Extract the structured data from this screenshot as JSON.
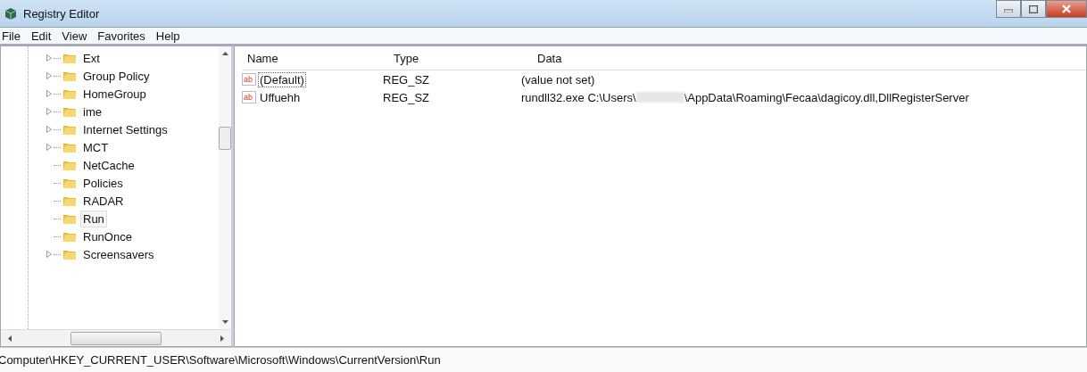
{
  "window": {
    "title": "Registry Editor"
  },
  "menu": [
    "File",
    "Edit",
    "View",
    "Favorites",
    "Help"
  ],
  "tree": [
    {
      "label": "Ext",
      "expandable": true,
      "selected": false
    },
    {
      "label": "Group Policy",
      "expandable": true,
      "selected": false
    },
    {
      "label": "HomeGroup",
      "expandable": true,
      "selected": false
    },
    {
      "label": "ime",
      "expandable": true,
      "selected": false
    },
    {
      "label": "Internet Settings",
      "expandable": true,
      "selected": false
    },
    {
      "label": "MCT",
      "expandable": true,
      "selected": false
    },
    {
      "label": "NetCache",
      "expandable": false,
      "selected": false
    },
    {
      "label": "Policies",
      "expandable": false,
      "selected": false
    },
    {
      "label": "RADAR",
      "expandable": false,
      "selected": false
    },
    {
      "label": "Run",
      "expandable": false,
      "selected": true
    },
    {
      "label": "RunOnce",
      "expandable": false,
      "selected": false
    },
    {
      "label": "Screensavers",
      "expandable": true,
      "selected": false
    }
  ],
  "table": {
    "columns": [
      "Name",
      "Type",
      "Data"
    ],
    "rows": [
      {
        "icon": "ab",
        "name": "(Default)",
        "type": "REG_SZ",
        "data": "(value not set)",
        "selected": true
      },
      {
        "icon": "ab",
        "name": "Uffuehh",
        "type": "REG_SZ",
        "data": "rundll32.exe C:\\Users\\",
        "data_after": "\\AppData\\Roaming\\Fecaa\\dagicoy.dll,DllRegisterServer",
        "redacted": true,
        "selected": false
      }
    ]
  },
  "status_bar": "Computer\\HKEY_CURRENT_USER\\Software\\Microsoft\\Windows\\CurrentVersion\\Run"
}
